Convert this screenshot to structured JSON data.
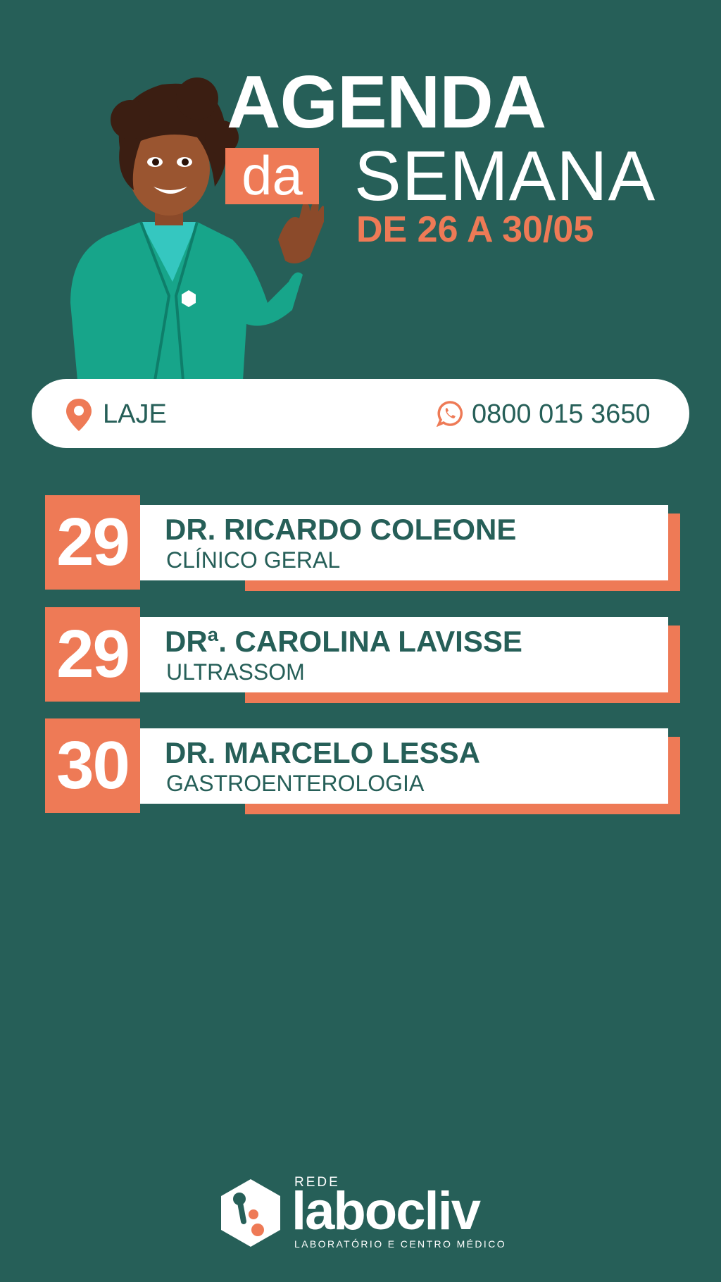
{
  "header": {
    "title": "AGENDA",
    "connector": "da",
    "subtitle": "SEMANA",
    "dates": "DE 26 A 30/05"
  },
  "info": {
    "location": "LAJE",
    "phone": "0800 015 3650",
    "location_icon": "map-pin-icon",
    "phone_icon": "whatsapp-icon"
  },
  "schedule": [
    {
      "day": "29",
      "doctor": "DR. RICARDO COLEONE",
      "specialty": "CLÍNICO GERAL"
    },
    {
      "day": "29",
      "doctor": "DRª. CAROLINA LAVISSE",
      "specialty": "ULTRASSOM"
    },
    {
      "day": "30",
      "doctor": "DR. MARCELO LESSA",
      "specialty": "GASTROENTEROLOGIA"
    }
  ],
  "footer": {
    "network": "REDE",
    "brand": "labocliv",
    "tagline": "LABORATÓRIO E CENTRO MÉDICO"
  },
  "colors": {
    "background": "#265F58",
    "accent": "#EE7A56",
    "white": "#FFFFFF"
  }
}
